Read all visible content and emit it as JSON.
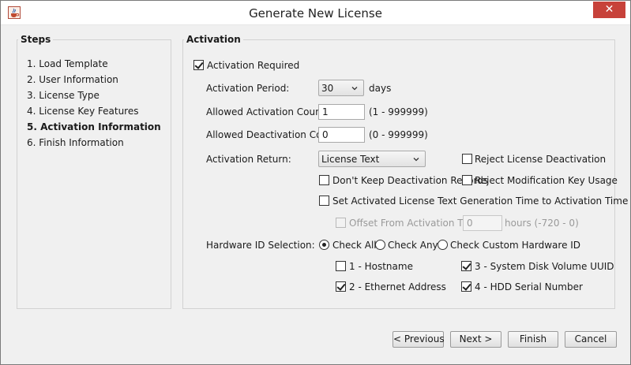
{
  "window": {
    "title": "Generate New License",
    "close_label": "✕",
    "icon": "java-cup-icon"
  },
  "steps": {
    "title": "Steps",
    "items": [
      {
        "label": "1. Load Template",
        "active": false
      },
      {
        "label": "2. User Information",
        "active": false
      },
      {
        "label": "3. License Type",
        "active": false
      },
      {
        "label": "4. License Key Features",
        "active": false
      },
      {
        "label": "5. Activation Information",
        "active": true
      },
      {
        "label": "6. Finish Information",
        "active": false
      }
    ]
  },
  "activation": {
    "title": "Activation",
    "required": {
      "label": "Activation Required",
      "checked": true
    },
    "period": {
      "label": "Activation Period:",
      "value": "30",
      "unit": "days"
    },
    "allowed_activation": {
      "label": "Allowed Activation Count:",
      "value": "1",
      "range": "(1 - 999999)"
    },
    "allowed_deactivation": {
      "label": "Allowed Deactivation Count:",
      "value": "0",
      "range": "(0 - 999999)"
    },
    "activation_return": {
      "label": "Activation Return:",
      "value": "License Text"
    },
    "reject_deactivation": {
      "label": "Reject License Deactivation",
      "checked": false
    },
    "dont_keep_records": {
      "label": "Don't Keep Deactivation Records",
      "checked": false
    },
    "reject_modification": {
      "label": "Reject Modification Key Usage",
      "checked": false
    },
    "set_generation_time": {
      "label": "Set Activated License Text Generation Time to Activation Time",
      "checked": false
    },
    "offset": {
      "label": "Offset From Activation Time:",
      "value": "0",
      "unit": "hours (-720 - 0)",
      "checked": false,
      "enabled": false
    },
    "hardware": {
      "label": "Hardware ID Selection:",
      "radios": [
        {
          "label": "Check All",
          "checked": true
        },
        {
          "label": "Check Any",
          "checked": false
        },
        {
          "label": "Check Custom Hardware ID",
          "checked": false
        }
      ],
      "ids": [
        {
          "label": "1 - Hostname",
          "checked": false
        },
        {
          "label": "3 - System Disk Volume UUID",
          "checked": true
        },
        {
          "label": "2 - Ethernet Address",
          "checked": true
        },
        {
          "label": "4 - HDD Serial Number",
          "checked": true
        }
      ]
    }
  },
  "buttons": {
    "previous": "< Previous",
    "next": "Next >",
    "finish": "Finish",
    "cancel": "Cancel"
  }
}
